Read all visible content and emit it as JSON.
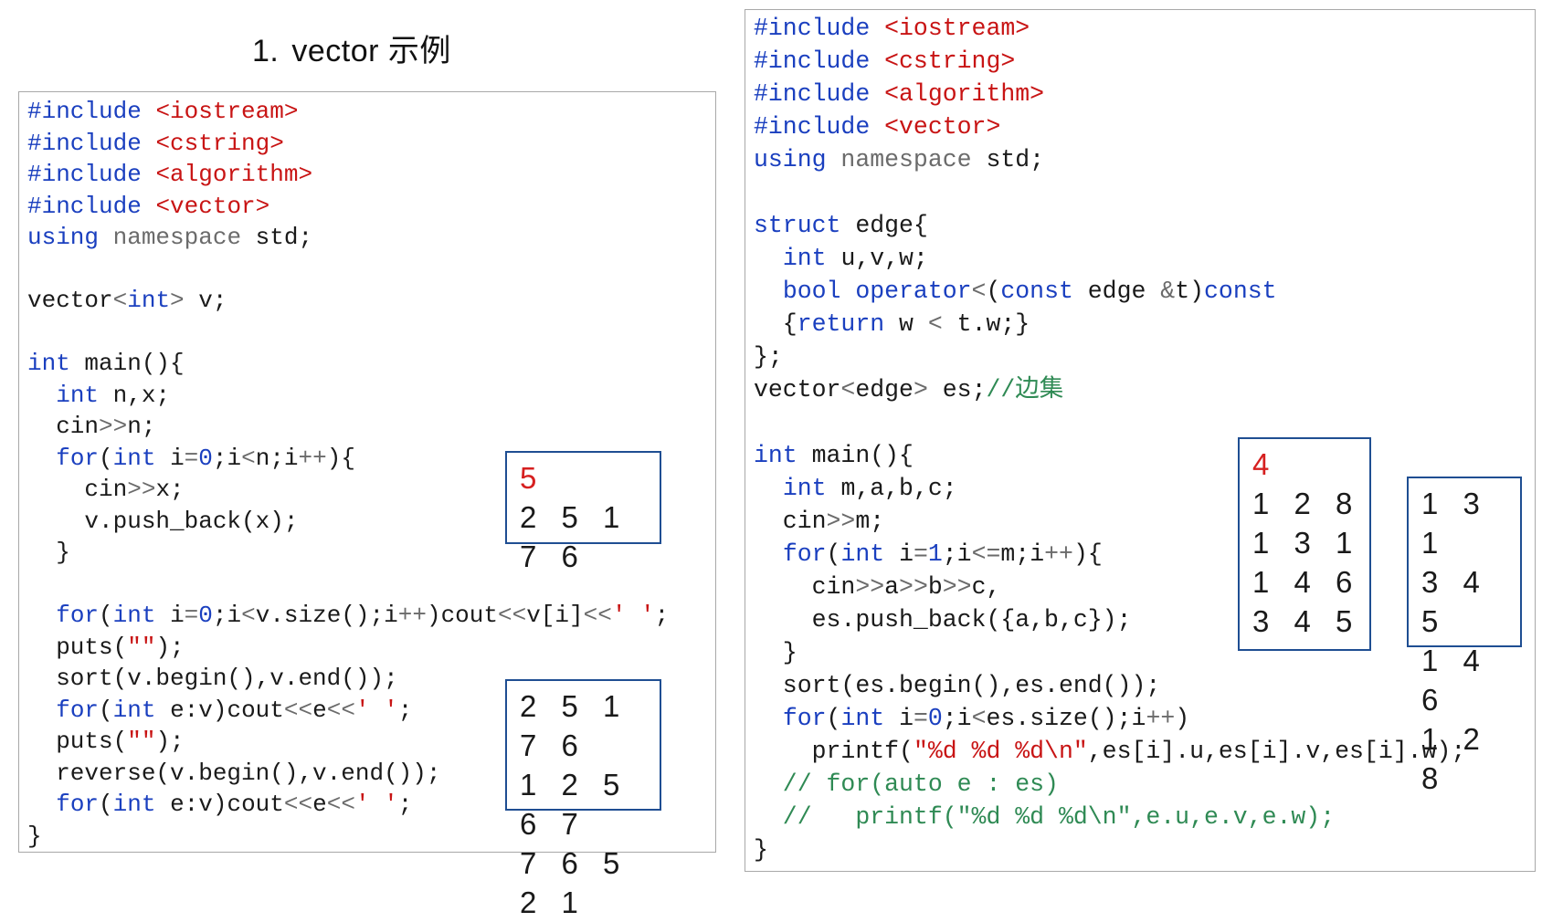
{
  "title": {
    "number": "1.",
    "text": "vector 示例"
  },
  "left_code": {
    "lines": [
      [
        [
          "pp",
          "#include "
        ],
        [
          "hdr",
          "<iostream>"
        ]
      ],
      [
        [
          "pp",
          "#include "
        ],
        [
          "hdr",
          "<cstring>"
        ]
      ],
      [
        [
          "pp",
          "#include "
        ],
        [
          "hdr",
          "<algorithm>"
        ]
      ],
      [
        [
          "pp",
          "#include "
        ],
        [
          "hdr",
          "<vector>"
        ]
      ],
      [
        [
          "kw",
          "using "
        ],
        [
          "ns",
          "namespace "
        ],
        [
          "txt",
          "std;"
        ]
      ],
      [],
      [
        [
          "txt",
          "vector"
        ],
        [
          "op",
          "<"
        ],
        [
          "kw",
          "int"
        ],
        [
          "op",
          "> "
        ],
        [
          "txt",
          "v;"
        ]
      ],
      [],
      [
        [
          "kw",
          "int "
        ],
        [
          "txt",
          "main(){"
        ]
      ],
      [
        [
          "txt",
          "  "
        ],
        [
          "kw",
          "int "
        ],
        [
          "txt",
          "n,x;"
        ]
      ],
      [
        [
          "txt",
          "  cin"
        ],
        [
          "op",
          ">>"
        ],
        [
          "txt",
          "n;"
        ]
      ],
      [
        [
          "txt",
          "  "
        ],
        [
          "kw",
          "for"
        ],
        [
          "txt",
          "("
        ],
        [
          "kw",
          "int "
        ],
        [
          "txt",
          "i"
        ],
        [
          "op",
          "="
        ],
        [
          "num",
          "0"
        ],
        [
          "txt",
          ";i"
        ],
        [
          "op",
          "<"
        ],
        [
          "txt",
          "n;i"
        ],
        [
          "op",
          "++"
        ],
        [
          "txt",
          "){"
        ]
      ],
      [
        [
          "txt",
          "    cin"
        ],
        [
          "op",
          ">>"
        ],
        [
          "txt",
          "x;"
        ]
      ],
      [
        [
          "txt",
          "    v.push_back(x);"
        ]
      ],
      [
        [
          "txt",
          "  }"
        ]
      ],
      [],
      [
        [
          "txt",
          "  "
        ],
        [
          "kw",
          "for"
        ],
        [
          "txt",
          "("
        ],
        [
          "kw",
          "int "
        ],
        [
          "txt",
          "i"
        ],
        [
          "op",
          "="
        ],
        [
          "num",
          "0"
        ],
        [
          "txt",
          ";i"
        ],
        [
          "op",
          "<"
        ],
        [
          "txt",
          "v.size();i"
        ],
        [
          "op",
          "++"
        ],
        [
          "txt",
          ")cout"
        ],
        [
          "op",
          "<<"
        ],
        [
          "txt",
          "v[i]"
        ],
        [
          "op",
          "<<"
        ],
        [
          "str",
          "' '"
        ],
        [
          "txt",
          ";"
        ]
      ],
      [
        [
          "txt",
          "  puts("
        ],
        [
          "str",
          "\"\""
        ],
        [
          "txt",
          ");"
        ]
      ],
      [
        [
          "txt",
          "  sort(v.begin(),v.end());"
        ]
      ],
      [
        [
          "txt",
          "  "
        ],
        [
          "kw",
          "for"
        ],
        [
          "txt",
          "("
        ],
        [
          "kw",
          "int "
        ],
        [
          "txt",
          "e:v)cout"
        ],
        [
          "op",
          "<<"
        ],
        [
          "txt",
          "e"
        ],
        [
          "op",
          "<<"
        ],
        [
          "str",
          "' '"
        ],
        [
          "txt",
          ";"
        ]
      ],
      [
        [
          "txt",
          "  puts("
        ],
        [
          "str",
          "\"\""
        ],
        [
          "txt",
          ");"
        ]
      ],
      [
        [
          "txt",
          "  reverse(v.begin(),v.end());"
        ]
      ],
      [
        [
          "txt",
          "  "
        ],
        [
          "kw",
          "for"
        ],
        [
          "txt",
          "("
        ],
        [
          "kw",
          "int "
        ],
        [
          "txt",
          "e:v)cout"
        ],
        [
          "op",
          "<<"
        ],
        [
          "txt",
          "e"
        ],
        [
          "op",
          "<<"
        ],
        [
          "str",
          "' '"
        ],
        [
          "txt",
          ";"
        ]
      ],
      [
        [
          "txt",
          "}"
        ]
      ]
    ]
  },
  "right_code": {
    "lines": [
      [
        [
          "pp",
          "#include "
        ],
        [
          "hdr",
          "<iostream>"
        ]
      ],
      [
        [
          "pp",
          "#include "
        ],
        [
          "hdr",
          "<cstring>"
        ]
      ],
      [
        [
          "pp",
          "#include "
        ],
        [
          "hdr",
          "<algorithm>"
        ]
      ],
      [
        [
          "pp",
          "#include "
        ],
        [
          "hdr",
          "<vector>"
        ]
      ],
      [
        [
          "kw",
          "using "
        ],
        [
          "ns",
          "namespace "
        ],
        [
          "txt",
          "std;"
        ]
      ],
      [],
      [
        [
          "kw",
          "struct "
        ],
        [
          "txt",
          "edge{"
        ]
      ],
      [
        [
          "txt",
          "  "
        ],
        [
          "kw",
          "int "
        ],
        [
          "txt",
          "u,v,w;"
        ]
      ],
      [
        [
          "txt",
          "  "
        ],
        [
          "kw",
          "bool operator"
        ],
        [
          "op",
          "<"
        ],
        [
          "txt",
          "("
        ],
        [
          "kw",
          "const "
        ],
        [
          "txt",
          "edge "
        ],
        [
          "op",
          "&"
        ],
        [
          "txt",
          "t)"
        ],
        [
          "kw",
          "const"
        ]
      ],
      [
        [
          "txt",
          "  {"
        ],
        [
          "kw",
          "return "
        ],
        [
          "txt",
          "w "
        ],
        [
          "op",
          "<"
        ],
        [
          "txt",
          " t.w;}"
        ]
      ],
      [
        [
          "txt",
          "};"
        ]
      ],
      [
        [
          "txt",
          "vector"
        ],
        [
          "op",
          "<"
        ],
        [
          "txt",
          "edge"
        ],
        [
          "op",
          "> "
        ],
        [
          "txt",
          "es;"
        ],
        [
          "cmt",
          "//边集"
        ]
      ],
      [],
      [
        [
          "kw",
          "int "
        ],
        [
          "txt",
          "main(){"
        ]
      ],
      [
        [
          "txt",
          "  "
        ],
        [
          "kw",
          "int "
        ],
        [
          "txt",
          "m,a,b,c;"
        ]
      ],
      [
        [
          "txt",
          "  cin"
        ],
        [
          "op",
          ">>"
        ],
        [
          "txt",
          "m;"
        ]
      ],
      [
        [
          "txt",
          "  "
        ],
        [
          "kw",
          "for"
        ],
        [
          "txt",
          "("
        ],
        [
          "kw",
          "int "
        ],
        [
          "txt",
          "i"
        ],
        [
          "op",
          "="
        ],
        [
          "num",
          "1"
        ],
        [
          "txt",
          ";i"
        ],
        [
          "op",
          "<="
        ],
        [
          "txt",
          "m;i"
        ],
        [
          "op",
          "++"
        ],
        [
          "txt",
          "){"
        ]
      ],
      [
        [
          "txt",
          "    cin"
        ],
        [
          "op",
          ">>"
        ],
        [
          "txt",
          "a"
        ],
        [
          "op",
          ">>"
        ],
        [
          "txt",
          "b"
        ],
        [
          "op",
          ">>"
        ],
        [
          "txt",
          "c,"
        ]
      ],
      [
        [
          "txt",
          "    es.push_back({a,b,c});"
        ]
      ],
      [
        [
          "txt",
          "  }"
        ]
      ],
      [
        [
          "txt",
          "  sort(es.begin(),es.end());"
        ]
      ],
      [
        [
          "txt",
          "  "
        ],
        [
          "kw",
          "for"
        ],
        [
          "txt",
          "("
        ],
        [
          "kw",
          "int "
        ],
        [
          "txt",
          "i"
        ],
        [
          "op",
          "="
        ],
        [
          "num",
          "0"
        ],
        [
          "txt",
          ";i"
        ],
        [
          "op",
          "<"
        ],
        [
          "txt",
          "es.size();i"
        ],
        [
          "op",
          "++"
        ],
        [
          "txt",
          ")"
        ]
      ],
      [
        [
          "txt",
          "    printf("
        ],
        [
          "str",
          "\"%d %d %d\\n\""
        ],
        [
          "txt",
          ",es[i].u,es[i].v,es[i].w);"
        ]
      ],
      [
        [
          "cmt",
          "  // for(auto e : es)"
        ]
      ],
      [
        [
          "cmt",
          "  //   printf(\"%d %d %d\\n\",e.u,e.v,e.w);"
        ]
      ],
      [
        [
          "txt",
          "}"
        ]
      ]
    ]
  },
  "io": {
    "left_input": {
      "first": "5",
      "rest": [
        "2 5 1 7 6"
      ]
    },
    "left_output": {
      "lines": [
        "2 5 1 7 6",
        "1 2 5 6 7",
        "7 6 5 2 1"
      ]
    },
    "right_input": {
      "first": "4",
      "rest": [
        "1 2 8",
        "1 3 1",
        "1 4 6",
        "3 4 5"
      ]
    },
    "right_output": {
      "lines": [
        "1 3 1",
        "3 4 5",
        "1 4 6",
        "1 2 8"
      ]
    }
  },
  "colors": {
    "keyword": "#1a3fbf",
    "header": "#c81414",
    "comment": "#2f8a54",
    "operator": "#6b6b6b",
    "io_border": "#1f4e92",
    "io_highlight": "#d62020"
  }
}
